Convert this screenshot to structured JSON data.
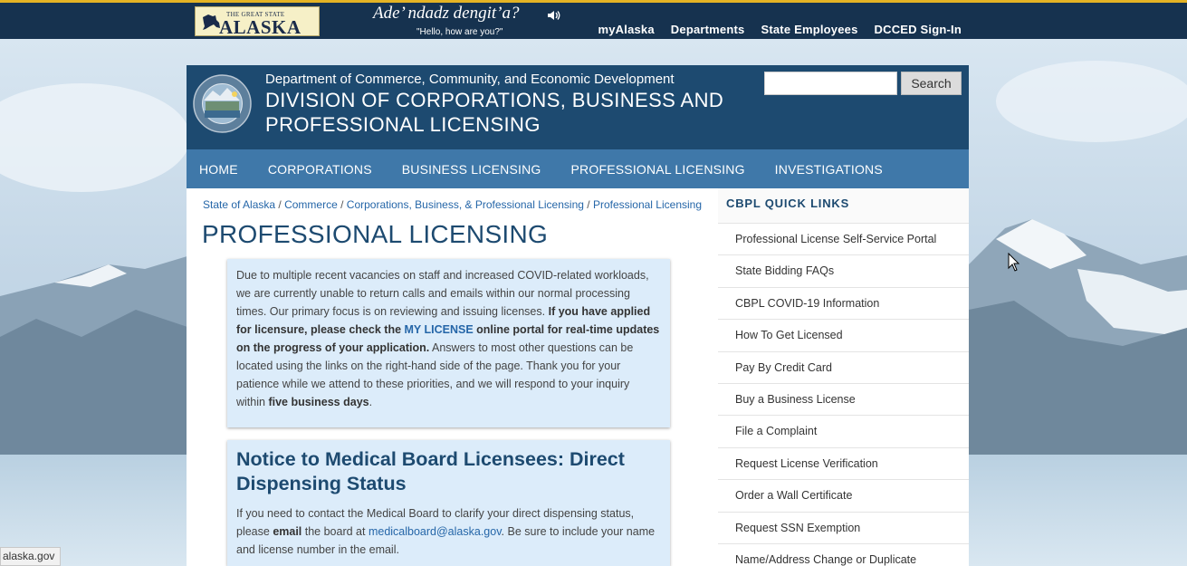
{
  "topbar": {
    "logo_small": "THE GREAT STATE",
    "logo_big": "ALASKA",
    "greeting": "Ade’ ndadz dengit’a?",
    "greeting_translation": "\"Hello, how are you?\"",
    "links": [
      "myAlaska",
      "Departments",
      "State Employees",
      "DCCED Sign-In"
    ]
  },
  "header": {
    "department": "Department of Commerce, Community, and Economic Development",
    "division": "DIVISION OF CORPORATIONS, BUSINESS AND PROFESSIONAL LICENSING",
    "search_button": "Search",
    "search_value": ""
  },
  "nav": [
    "HOME",
    "CORPORATIONS",
    "BUSINESS LICENSING",
    "PROFESSIONAL LICENSING",
    "INVESTIGATIONS"
  ],
  "breadcrumb": [
    "State of Alaska",
    "Commerce",
    "Corporations, Business, & Professional Licensing",
    "Professional Licensing"
  ],
  "breadcrumb_sep": " / ",
  "page_title": "PROFESSIONAL LICENSING",
  "notice1": {
    "text_a": "Due to multiple recent vacancies on staff and increased COVID-related workloads, we are currently unable to return calls and emails within our normal processing times. Our primary focus is on reviewing and issuing licenses. ",
    "bold_a": "If you have applied for licensure, please check the ",
    "link": "MY LICENSE",
    "bold_b": " online portal for real-time updates on the progress of your application.",
    "text_b": " Answers to most other questions can be located using the links on the right-hand side of the page. Thank you for your patience while we attend to these priorities, and we will respond to your inquiry within ",
    "bold_c": "five business days",
    "text_c": "."
  },
  "notice2": {
    "title": "Notice to Medical Board Licensees: Direct Dispensing Status",
    "text_a": "If you need to contact the Medical Board to clarify your direct dispensing status, please ",
    "bold_a": "email",
    "text_b": " the board at ",
    "link": "medicalboard@alaska.gov",
    "text_c": ". Be sure to include your name and license number in the email."
  },
  "quick_links": {
    "title": "CBPL QUICK LINKS",
    "items": [
      "Professional License Self-Service Portal",
      "State Bidding FAQs",
      "CBPL COVID-19 Information",
      "How To Get Licensed",
      "Pay By Credit Card",
      "Buy a Business License",
      "File a Complaint",
      "Request License Verification",
      "Order a Wall Certificate",
      "Request SSN Exemption",
      "Name/Address Change or Duplicate"
    ]
  },
  "status_tip": "alaska.gov",
  "colors": {
    "topbar": "#16324f",
    "topbar_accent": "#e4b324",
    "header": "#1d4a70",
    "nav": "#3f78a9",
    "notice_bg": "#dcecfa",
    "link": "#2566a8"
  },
  "icons": [
    "alaska-map-icon",
    "speaker-icon",
    "state-seal-icon",
    "mouse-cursor-icon"
  ]
}
